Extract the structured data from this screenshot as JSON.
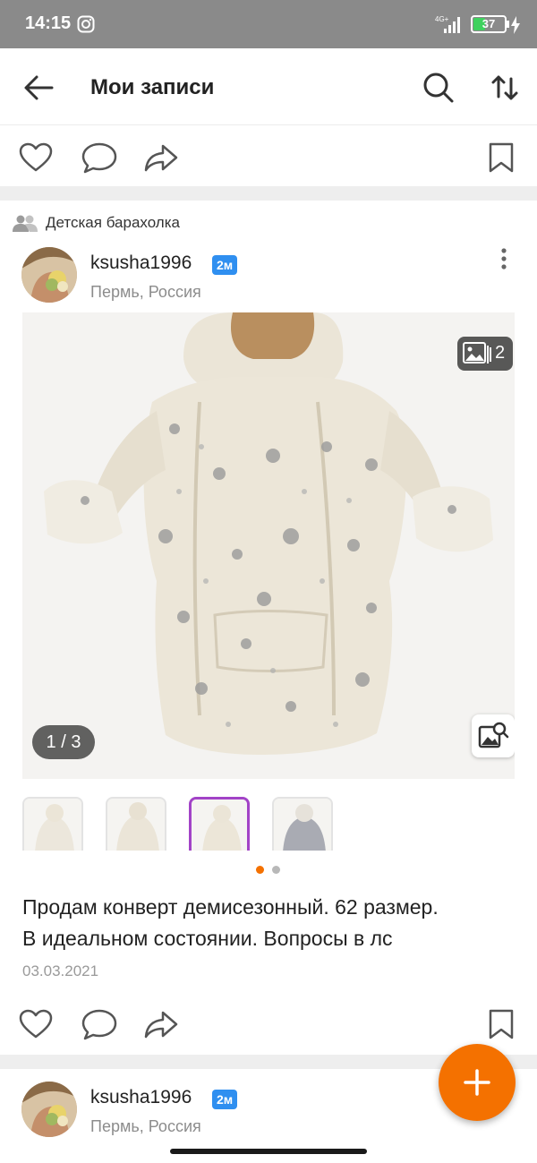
{
  "status_bar": {
    "time": "14:15",
    "network": "4G+",
    "battery": "37",
    "battery_level": 0.37,
    "icons": [
      "instagram-icon",
      "signal-icon",
      "battery-icon",
      "charging-icon"
    ]
  },
  "app_bar": {
    "title": "Мои записи",
    "icons": [
      "back-arrow-icon",
      "search-icon",
      "sort-icon"
    ]
  },
  "group": {
    "name": "Детская барахолка"
  },
  "post": {
    "author": "ksusha1996",
    "age_badge": "2м",
    "location": "Пермь, Россия",
    "photo_count": "2",
    "pager": "1 / 3",
    "carousel_dots": {
      "total": 2,
      "active_index": 0
    },
    "text_line1": "Продам конверт демисезонный. 62 размер.",
    "text_line2": "В идеальном состоянии. Вопросы в лс",
    "date": "03.03.2021"
  },
  "next_post": {
    "author": "ksusha1996",
    "age_badge": "2м",
    "location": "Пермь, Россия"
  },
  "colors": {
    "accent_orange": "#f47100",
    "badge_blue": "#2f8ff0",
    "selected_thumb": "#a243c7",
    "status_bar_bg": "#8a8a8a",
    "icon_gray": "#4a4a4a"
  }
}
